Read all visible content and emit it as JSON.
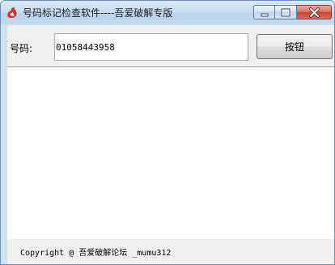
{
  "window": {
    "title": "号码标记检查软件----吾爱破解专版",
    "icon": "app-flame-icon",
    "controls": [
      "minimize-icon",
      "maximize-icon",
      "close-icon"
    ]
  },
  "form": {
    "phone_label": "号码:",
    "phone_value": "01058443958",
    "button_label": "按钮"
  },
  "output": {
    "text": ""
  },
  "footer": {
    "text": "Copyright @ 吾爱破解论坛 _mumu312"
  },
  "colors": {
    "titlebar": "#c7dbf0",
    "client_bg": "#f0f0f0",
    "close_button": "#c4442c",
    "app_icon": "#d8332a"
  }
}
